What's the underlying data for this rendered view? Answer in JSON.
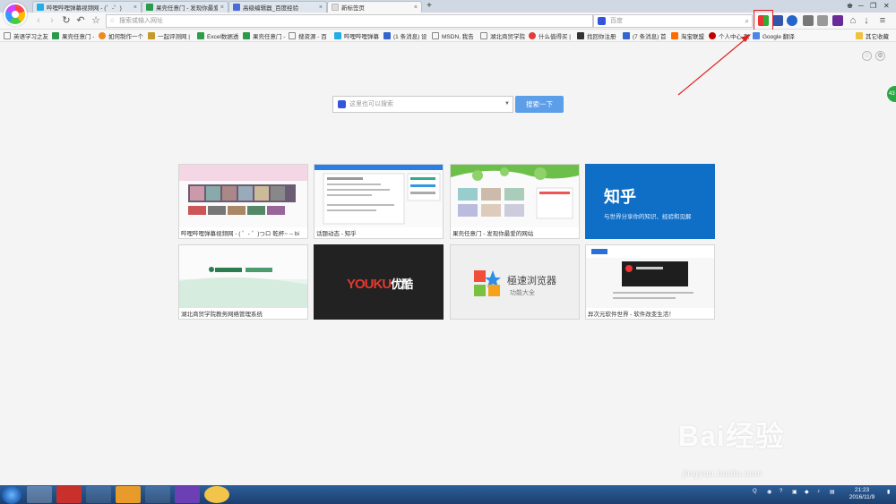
{
  "tabs": [
    {
      "label": "哔哩哔哩弹幕视频网 - (゜-゜)",
      "icon_color": "#23ade5"
    },
    {
      "label": "果壳任意门 - 发现你最爱的网",
      "icon_color": "#2a9b4a"
    },
    {
      "label": "高级编辑器_百度经验",
      "icon_color": "#4a6cd4"
    },
    {
      "label": "新标签页",
      "icon_color": "#cccccc"
    }
  ],
  "new_tab_symbol": "+",
  "address_bar": {
    "placeholder": "搜索或输入网址"
  },
  "search_bar": {
    "placeholder": "百度"
  },
  "bookmarks": [
    {
      "label": "英语学习之友",
      "icon": "page-icon",
      "color": "#888888"
    },
    {
      "label": "果壳任意门 -",
      "icon": "guokr-icon",
      "color": "#2a9b4a"
    },
    {
      "label": "如何制作一个",
      "icon": "baidu-jingyan-icon",
      "color": "#ee8a1c"
    },
    {
      "label": "一起评测网 |",
      "icon": "review-icon",
      "color": "#c69a2a"
    },
    {
      "label": "Excel数据透",
      "icon": "excel-icon",
      "color": "#2f9c4a"
    },
    {
      "label": "果壳任意门 -",
      "icon": "guokr-icon",
      "color": "#2a9b4a"
    },
    {
      "label": "搜资源 - 百",
      "icon": "page-icon",
      "color": "#888888"
    },
    {
      "label": "哔哩哔哩弹幕",
      "icon": "bilibili-icon",
      "color": "#23ade5"
    },
    {
      "label": "(1 条消息) 设",
      "icon": "csdn-icon",
      "color": "#3366cc"
    },
    {
      "label": "MSDN, 我告",
      "icon": "page-icon",
      "color": "#888888"
    },
    {
      "label": "湖北商贸学院",
      "icon": "page-icon",
      "color": "#888888"
    },
    {
      "label": "什么值得买 |",
      "icon": "smzdm-icon",
      "color": "#e23b3b"
    },
    {
      "label": "找回你注册",
      "icon": "register-icon",
      "color": "#333333"
    },
    {
      "label": "(7 条消息) 首",
      "icon": "csdn-icon",
      "color": "#3366cc"
    },
    {
      "label": "淘宝联盟",
      "icon": "taobao-icon",
      "color": "#ff6a00"
    },
    {
      "label": "个人中心-联",
      "icon": "personal-icon",
      "color": "#c00000"
    },
    {
      "label": "Google 翻译",
      "icon": "google-translate-icon",
      "color": "#4a86e8"
    }
  ],
  "other_bookmarks": "其它收藏",
  "main_search": {
    "placeholder": "这里也可以搜索",
    "button": "搜索一下"
  },
  "tiles": [
    {
      "caption": "哔哩哔哩弹幕视频网 - ( ゜- ゜)つロ 乾杯~ -- bi"
    },
    {
      "caption": "话题动态 - 知乎"
    },
    {
      "caption": "果壳任意门 - 发现你最爱的网站"
    },
    {
      "caption": "",
      "logo_text": "知乎",
      "slogan": "与世界分享你的知识、经验和见解",
      "bg": "#0f6fc6"
    },
    {
      "caption": "湖北商贸学院教务网络管理系统"
    },
    {
      "caption": "",
      "logo_text_a": "YOUKU",
      "logo_text_b": "优酷",
      "bg": "#222222"
    },
    {
      "caption": "",
      "title": "極速浏览器",
      "subtitle": "功能大全"
    },
    {
      "caption": "异次元软件世界 - 软件改变生活！"
    }
  ],
  "side_badge": "43",
  "watermark": {
    "main": "Bai经验",
    "sub": "jingyan.baidu.com"
  },
  "clock": {
    "time": "21:23",
    "date": "2016/11/9"
  },
  "accent_color": "#5d9ee9",
  "highlight_color": "#e02020"
}
